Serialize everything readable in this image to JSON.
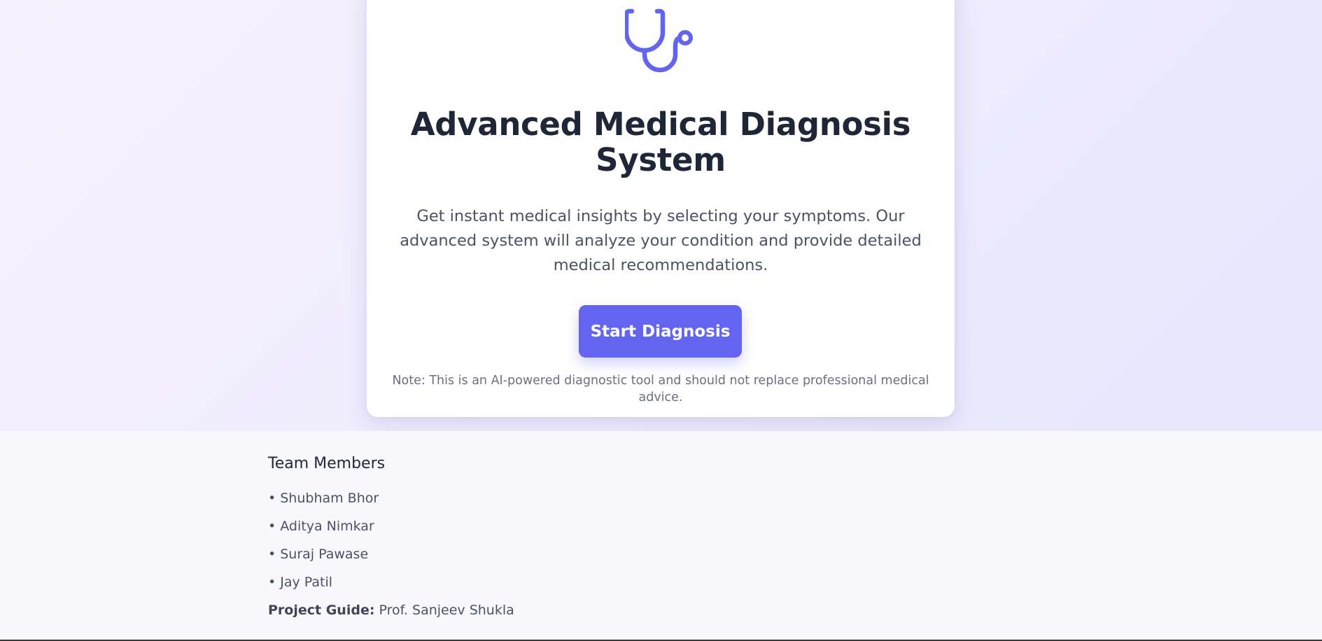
{
  "hero": {
    "title": "Advanced Medical Diagnosis System",
    "description": "Get instant medical insights by selecting your symptoms. Our advanced system will analyze your condition and provide detailed medical recommendations.",
    "start_button_label": "Start Diagnosis",
    "note": "Note: This is an AI-powered diagnostic tool and should not replace professional medical advice.",
    "icon": "stethoscope-icon"
  },
  "team": {
    "title": "Team Members",
    "members": [
      "• Shubham Bhor",
      "• Aditya Nimkar",
      "• Suraj Pawase",
      "• Jay Patil"
    ],
    "guide_label": "Project Guide:",
    "guide_name": "Prof. Sanjeev Shukla"
  },
  "colors": {
    "accent": "#6364ef",
    "title": "#1e2637",
    "text": "#4a5263"
  }
}
